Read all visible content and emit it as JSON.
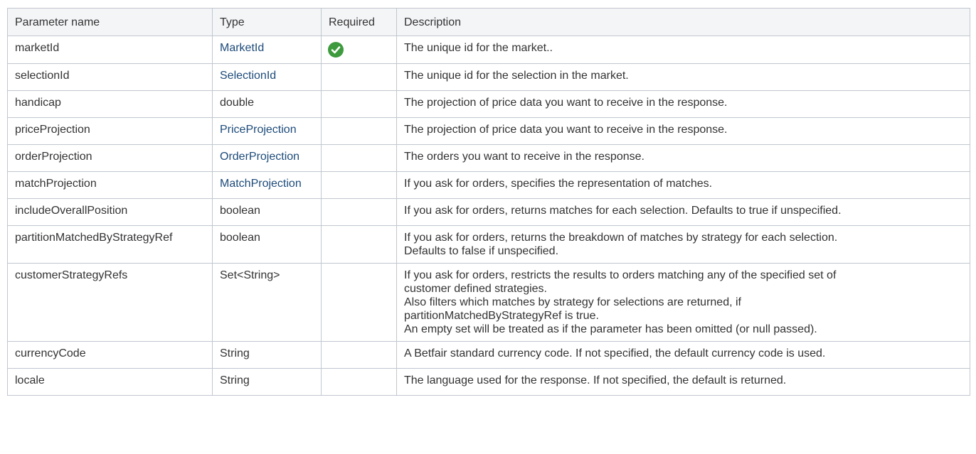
{
  "headers": {
    "name": "Parameter name",
    "type": "Type",
    "required": "Required",
    "description": "Description"
  },
  "colors": {
    "link": "#1d4b7a",
    "check": "#3d9a3d",
    "header_bg": "#f4f5f7",
    "border": "#c1c7d0"
  },
  "rows": [
    {
      "name": "marketId",
      "type": "MarketId",
      "type_is_link": true,
      "required": true,
      "required_icon": "check-icon",
      "description": "The unique id for the market.."
    },
    {
      "name": "selectionId",
      "type": "SelectionId",
      "type_is_link": true,
      "required": false,
      "description": "The unique id for the selection in the market."
    },
    {
      "name": "handicap",
      "type": "double",
      "type_is_link": false,
      "required": false,
      "description": "The projection of price data you want to receive in the response."
    },
    {
      "name": "priceProjection",
      "type": "PriceProjection",
      "type_is_link": true,
      "required": false,
      "description": "The projection of price data you want to receive in the response."
    },
    {
      "name": "orderProjection",
      "type": "OrderProjection",
      "type_is_link": true,
      "required": false,
      "description": "The orders you want to receive in the response."
    },
    {
      "name": "matchProjection",
      "type": "MatchProjection",
      "type_is_link": true,
      "required": false,
      "description": "If you ask for orders, specifies the representation of matches."
    },
    {
      "name": "includeOverallPosition",
      "type": "boolean",
      "type_is_link": false,
      "required": false,
      "description": "If you ask for orders, returns matches for each selection. Defaults to true if unspecified."
    },
    {
      "name": "partitionMatchedByStrategyRef",
      "type": "boolean",
      "type_is_link": false,
      "required": false,
      "description": "If you ask for orders, returns the breakdown of matches by strategy for each selection.\nDefaults to false if unspecified."
    },
    {
      "name": "customerStrategyRefs",
      "type": "Set<String>",
      "type_is_link": false,
      "required": false,
      "description": "If you ask for orders, restricts the results to orders matching any of the specified set of\ncustomer defined strategies.\nAlso filters which matches by strategy for selections are returned, if\npartitionMatchedByStrategyRef is true.\nAn empty set will be treated as if the parameter has been omitted (or null passed)."
    },
    {
      "name": "currencyCode",
      "type": "String",
      "type_is_link": false,
      "required": false,
      "description": "A Betfair standard currency code. If not specified, the default currency code is used."
    },
    {
      "name": "locale",
      "type": "String",
      "type_is_link": false,
      "required": false,
      "description": "The language used for the response. If not specified, the default is returned."
    }
  ]
}
